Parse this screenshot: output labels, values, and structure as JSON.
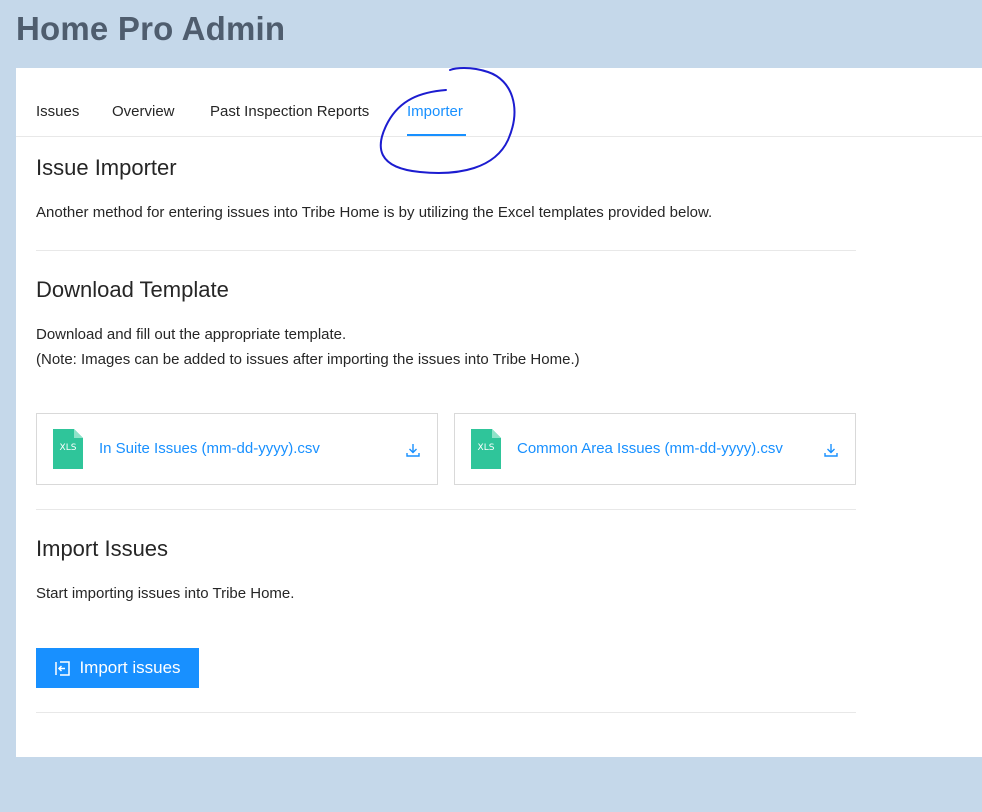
{
  "app": {
    "title": "Home Pro Admin"
  },
  "tabs": [
    {
      "label": "Issues",
      "active": false
    },
    {
      "label": "Overview",
      "active": false
    },
    {
      "label": "Past Inspection Reports",
      "active": false
    },
    {
      "label": "Importer",
      "active": true
    }
  ],
  "importer": {
    "heading": "Issue Importer",
    "description": "Another method for entering issues into Tribe Home is by utilizing the Excel templates provided below."
  },
  "download": {
    "heading": "Download Template",
    "line1": "Download and fill out the appropriate template.",
    "line2": "(Note: Images can be added to issues after importing the issues into Tribe Home.)",
    "files": [
      {
        "icon": "xls-file-icon",
        "icon_text": "XLS",
        "name": "In Suite Issues (mm-dd-yyyy).csv"
      },
      {
        "icon": "xls-file-icon",
        "icon_text": "XLS",
        "name": "Common Area Issues (mm-dd-yyyy).csv"
      }
    ]
  },
  "import": {
    "heading": "Import Issues",
    "description": "Start importing issues into Tribe Home.",
    "button_label": "Import issues",
    "button_icon": "import-icon"
  },
  "colors": {
    "background": "#c5d8ea",
    "accent": "#1890ff",
    "xls_icon": "#2fc59a",
    "title": "#4f5d6e",
    "annotation": "#1c1cd0"
  }
}
